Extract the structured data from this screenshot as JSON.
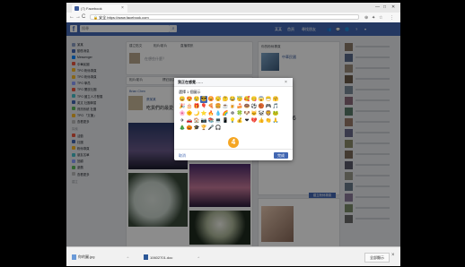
{
  "browser": {
    "tab_title": "(7) Facebook",
    "url_secure": "安全",
    "url": "https://www.facebook.com",
    "window_controls": [
      "—",
      "□",
      "✕"
    ]
  },
  "fb": {
    "search_placeholder": "搜尋",
    "nav": [
      "某某",
      "首頁",
      "尋找朋友"
    ]
  },
  "sidebar": {
    "items": [
      {
        "label": "某某",
        "color": "#8b9dc3"
      },
      {
        "label": "動態消息",
        "color": "#4267b2"
      },
      {
        "label": "Messenger",
        "color": "#0084ff"
      },
      {
        "label": "中華民國",
        "color": "#e9573f"
      },
      {
        "label": "TPO 粉絲專頁",
        "color": "#f7b928"
      },
      {
        "label": "TPO 粉絲專頁",
        "color": "#f7b928"
      },
      {
        "label": "TPO 學員",
        "color": "#8c9eff"
      },
      {
        "label": "TPO 開放社團",
        "color": "#e9573f"
      },
      {
        "label": "TPO 國立人才發展",
        "color": "#44bec7"
      },
      {
        "label": "英文 社團學習",
        "color": "#4267b2"
      },
      {
        "label": "資訊系統 社團",
        "color": "#5cb85c"
      },
      {
        "label": "TPO 「文筆」",
        "color": "#f7b928"
      },
      {
        "label": "查看更多",
        "color": "#bbbbbb"
      }
    ],
    "sections": [
      "探索",
      "建立"
    ],
    "explore": [
      {
        "label": "活動",
        "color": "#e9573f"
      },
      {
        "label": "社團",
        "color": "#4267b2"
      },
      {
        "label": "粉絲專頁",
        "color": "#f7b928"
      },
      {
        "label": "朋友名單",
        "color": "#44bec7"
      },
      {
        "label": "回顧",
        "color": "#8c9eff"
      },
      {
        "label": "遊戲",
        "color": "#5cb85c"
      },
      {
        "label": "查看更多",
        "color": "#bbbbbb"
      }
    ]
  },
  "feed": {
    "composer_tabs": [
      "建立貼文",
      "相片/影片",
      "直播視訊"
    ],
    "composer_placeholder": "在想些什麼？",
    "tabs": [
      "相片/影片",
      "標註朋友"
    ],
    "post_author": "Brian Chen",
    "post_author2": "張某某",
    "post_text": "吃貨們的最愛"
  },
  "right": {
    "header": "你的粉絲專頁",
    "page_name": "中華民國",
    "stat": "186",
    "button": "建立粉絲專頁"
  },
  "dialog": {
    "title": "我正在感覺……",
    "subtitle": "選擇 1 個圖示",
    "stickers": [
      "😀",
      "😍",
      "😢",
      "😎",
      "😡",
      "😴",
      "🤔",
      "😂",
      "😇",
      "🥰",
      "😋",
      "😱",
      "😷",
      "🤗",
      "🎉",
      "🎂",
      "🎁",
      "🎈",
      "🍕",
      "🍔",
      "☕",
      "🍺",
      "🍰",
      "🍩",
      "⚽",
      "🏀",
      "🎮",
      "🎵",
      "🌸",
      "🌞",
      "🌙",
      "⭐",
      "🔥",
      "💧",
      "🌈",
      "❄",
      "🍀",
      "🐶",
      "🐱",
      "🐼",
      "🦁",
      "🐸",
      "✈",
      "🚗",
      "🏠",
      "📷",
      "📚",
      "💻",
      "📱",
      "💡",
      "💰",
      "❤",
      "💔",
      "👍",
      "👏",
      "🙏",
      "🎄",
      "🎃",
      "🎓",
      "🏆",
      "🎤",
      "🎧"
    ],
    "selected_index": 3,
    "cancel": "取消",
    "done": "完成"
  },
  "step_badge": "4",
  "downloads": {
    "items": [
      "你的圖.jpg",
      "10602701.doc"
    ],
    "show_all": "全部顯示"
  }
}
